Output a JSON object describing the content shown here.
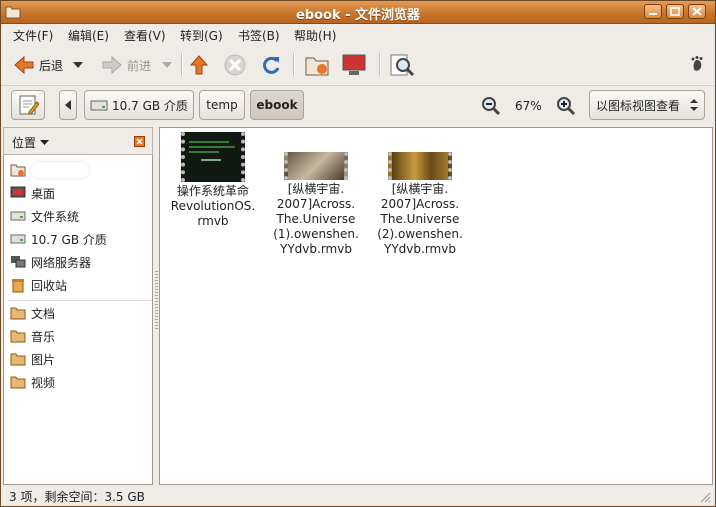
{
  "window": {
    "title": "ebook - 文件浏览器"
  },
  "menubar": [
    "文件(F)",
    "编辑(E)",
    "查看(V)",
    "转到(G)",
    "书签(B)",
    "帮助(H)"
  ],
  "toolbar": {
    "back": "后退",
    "forward": "前进"
  },
  "location": {
    "drive": "10.7 GB 介质",
    "crumbs": [
      "temp",
      "ebook"
    ],
    "zoom": "67%",
    "view_mode": "以图标视图查看"
  },
  "sidebar": {
    "header": "位置",
    "items": [
      "桌面",
      "文件系统",
      "10.7 GB 介质",
      "网络服务器",
      "回收站"
    ],
    "bookmarks": [
      "文档",
      "音乐",
      "图片",
      "视频"
    ]
  },
  "files": [
    {
      "name": [
        "操作系统革命",
        "RevolutionOS.",
        "rmvb"
      ],
      "thumb": "terminal"
    },
    {
      "name": [
        "[纵横宇宙.",
        "2007]Across.",
        "The.Universe",
        "(1).owenshen.",
        "YYdvb.rmvb"
      ],
      "thumb": "desk"
    },
    {
      "name": [
        "[纵横宇宙.",
        "2007]Across.",
        "The.Universe",
        "(2).owenshen.",
        "YYdvb.rmvb"
      ],
      "thumb": "crowd"
    }
  ],
  "status": "3 项，剩余空间：3.5 GB",
  "colors": {
    "titlebar": "#c7762c",
    "accent": "#e8752a"
  }
}
